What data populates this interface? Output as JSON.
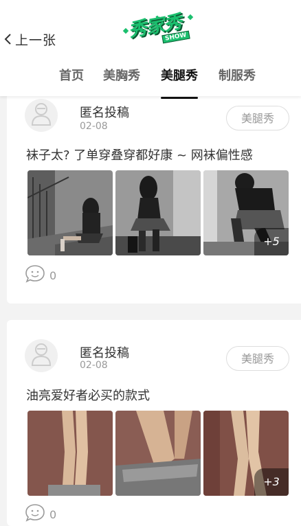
{
  "header": {
    "back_label": "上一张",
    "logo_text": "秀家秀",
    "logo_badge": "SHOW"
  },
  "tabs": [
    {
      "label": "首页",
      "active": false
    },
    {
      "label": "美胸秀",
      "active": false
    },
    {
      "label": "美腿秀",
      "active": true
    },
    {
      "label": "制服秀",
      "active": false
    }
  ],
  "posts": [
    {
      "author": "匿名投稿",
      "date": "02-08",
      "tag": "美腿秀",
      "title": "袜子太? 了单穿叠穿都好康 ~ 网袜偏性感",
      "more_count": "+5",
      "comments": "0"
    },
    {
      "author": "匿名投稿",
      "date": "02-08",
      "tag": "美腿秀",
      "title": "油亮爱好者必买的款式",
      "more_count": "+3",
      "comments": "0"
    }
  ],
  "colors": {
    "brand_green": "#1bbf6e",
    "active_tab": "#111111",
    "muted": "#999999"
  },
  "icons": [
    "chevron-left-icon",
    "avatar-placeholder-icon",
    "comment-bubble-icon"
  ]
}
